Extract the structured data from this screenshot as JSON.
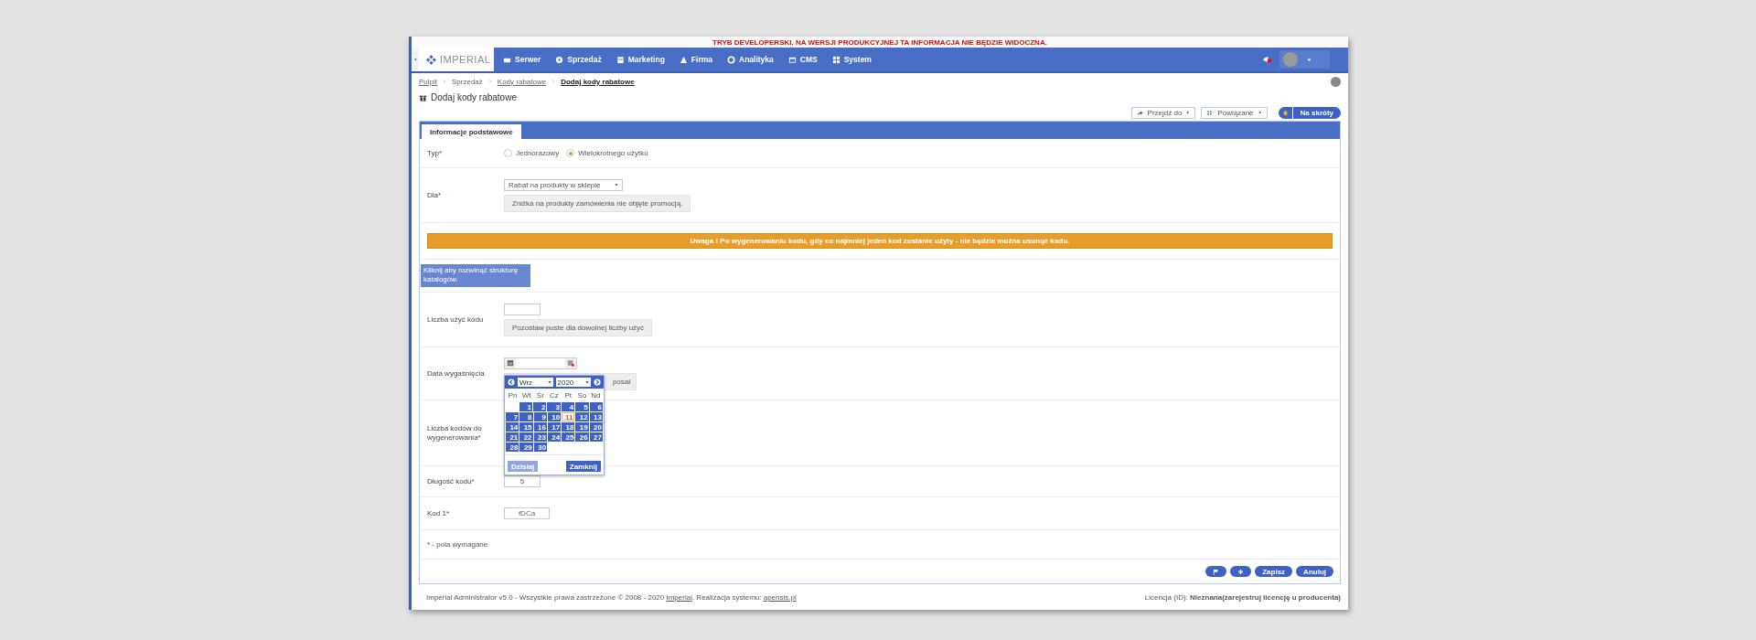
{
  "dev_notice": "TRYB DEVELOPERSKI. NA WERSJI PRODUKCYJNEJ TA INFORMACJA NIE BĘDZIE WIDOCZNA.",
  "navbar": {
    "logo": "IMPERIAL",
    "items": [
      {
        "label": "Serwer"
      },
      {
        "label": "Sprzedaż"
      },
      {
        "label": "Marketing"
      },
      {
        "label": "Firma"
      },
      {
        "label": "Analityka"
      },
      {
        "label": "CMS"
      },
      {
        "label": "System"
      }
    ]
  },
  "breadcrumb": [
    {
      "label": "Pulpit",
      "kind": "link"
    },
    {
      "label": "Sprzedaż",
      "kind": "text"
    },
    {
      "label": "Kody rabatowe",
      "kind": "link"
    },
    {
      "label": "Dodaj kody rabatowe",
      "kind": "current"
    }
  ],
  "page_title": "Dodaj kody rabatowe",
  "toolbar": [
    {
      "label": "Przejdź do"
    },
    {
      "label": "Powiązane"
    }
  ],
  "favorite": {
    "label": "Na skróty"
  },
  "tabs": [
    {
      "label": "Informacje podstawowe",
      "selected": true
    }
  ],
  "form": {
    "required_mark": "*",
    "rows": [
      {
        "kind": "radio",
        "label": "Typ",
        "required": true,
        "options": [
          {
            "label": "Jednorazowy",
            "selected": false
          },
          {
            "label": "Wielokrotnego użytku",
            "selected": true
          }
        ]
      },
      {
        "kind": "select",
        "label": "Dla",
        "required": true,
        "value": "Rabat na produkty w sklepie",
        "hint": "Zniżka na produkty zamówienia nie objęte promocją."
      },
      {
        "kind": "alert",
        "text": "Uwaga ! Po wygenerowaniu kodu, gdy co najmniej jeden kod zostanie użyty - nie będzie można usunąć kodu."
      },
      {
        "kind": "tooltip",
        "text": "Kliknij aby rozwinąć strukturę katalogów."
      },
      {
        "kind": "input",
        "label": "Liczba użyć kodu",
        "required": false,
        "hint": "Pozostaw puste dla dowolnej liczby użyć"
      },
      {
        "kind": "date",
        "label": "Data wygaśnięcia",
        "required": false,
        "hint": "posał"
      },
      {
        "kind": "input",
        "label": "Liczba kodów do wygenerowania",
        "required": true
      },
      {
        "kind": "input",
        "label": "Długość kodu",
        "required": true,
        "value": "5"
      },
      {
        "kind": "input",
        "label": "Kod 1",
        "required": true,
        "value": "fDCa"
      },
      {
        "kind": "note",
        "text": "- pola wymagane"
      }
    ]
  },
  "calendar": {
    "month": "Wrz",
    "year": "2020",
    "weekdays": [
      "Pn",
      "Wt",
      "Śr",
      "Cz",
      "Pt",
      "So",
      "Nd"
    ],
    "weeks": [
      [
        {
          "label": "1",
          "selected": false
        },
        {
          "label": "2",
          "selected": false
        },
        {
          "label": "3",
          "selected": false
        },
        {
          "label": "4",
          "selected": false
        },
        {
          "label": "5",
          "selected": false
        },
        {
          "label": "6",
          "selected": false
        }
      ],
      [
        {
          "label": "7",
          "selected": false
        },
        {
          "label": "8",
          "selected": false
        },
        {
          "label": "9",
          "selected": false
        },
        {
          "label": "10",
          "selected": false
        },
        {
          "label": "11",
          "selected": true
        },
        {
          "label": "12",
          "selected": false
        },
        {
          "label": "13",
          "selected": false
        }
      ],
      [
        {
          "label": "14",
          "selected": false
        },
        {
          "label": "15",
          "selected": false
        },
        {
          "label": "16",
          "selected": false
        },
        {
          "label": "17",
          "selected": false
        },
        {
          "label": "18",
          "selected": false
        },
        {
          "label": "19",
          "selected": false
        },
        {
          "label": "20",
          "selected": false
        }
      ],
      [
        {
          "label": "21",
          "selected": false
        },
        {
          "label": "22",
          "selected": false
        },
        {
          "label": "23",
          "selected": false
        },
        {
          "label": "24",
          "selected": false
        },
        {
          "label": "25",
          "selected": false
        },
        {
          "label": "26",
          "selected": false
        },
        {
          "label": "27",
          "selected": false
        }
      ],
      [
        {
          "label": "28",
          "selected": false
        },
        {
          "label": "29",
          "selected": false
        },
        {
          "label": "30",
          "selected": false
        }
      ]
    ],
    "buttons": [
      "Dzisiaj",
      "Zamknij"
    ]
  },
  "actions": [
    {
      "kind": "flag"
    },
    {
      "kind": "plus"
    },
    {
      "kind": "text",
      "label": "Zapisz"
    },
    {
      "kind": "text",
      "label": "Anuluj"
    }
  ],
  "footer": {
    "copyright": [
      {
        "kind": "text",
        "text": "Imperial Administrator v5.0 - Wszystkie prawa zastrzeżone © 2008 - 2020 "
      },
      {
        "kind": "link",
        "text": "Imperial"
      },
      {
        "kind": "text",
        "text": ". Realizacja systemu: "
      },
      {
        "kind": "link",
        "text": "apensis.pl"
      }
    ],
    "license": "Licencja (ID): **Nieznana(zarejestruj licencję u producenta)**"
  }
}
